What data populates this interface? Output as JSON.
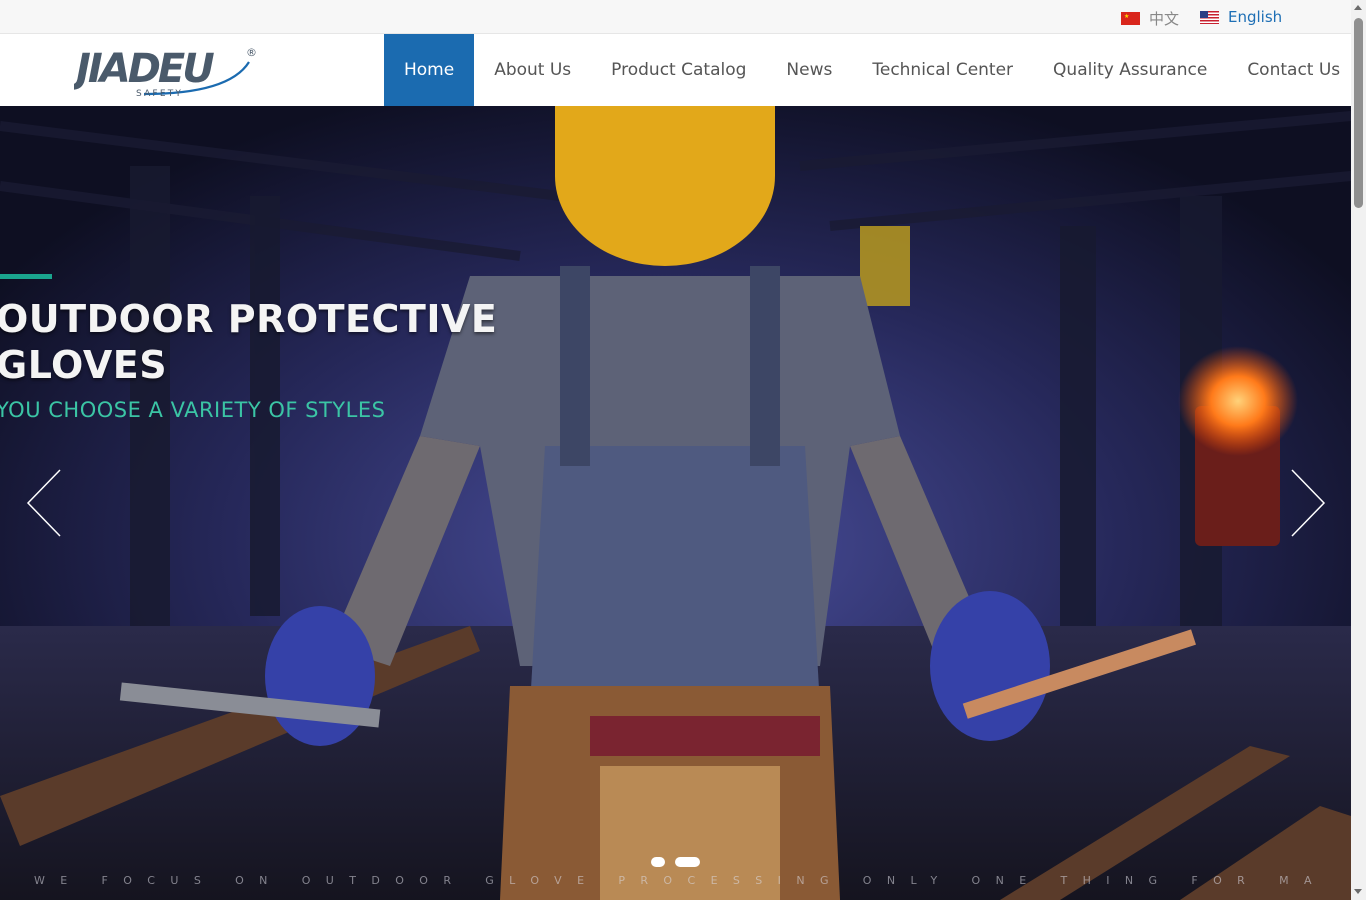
{
  "languages": [
    {
      "label": "中文",
      "icon": "china-flag-icon"
    },
    {
      "label": "English",
      "icon": "us-flag-icon",
      "active": true
    }
  ],
  "brand": {
    "name": "JIADEU",
    "sub": "SAFETY",
    "mark": "®",
    "color": "#4a5a6b",
    "accent": "#1b6bb0"
  },
  "nav": {
    "items": [
      "Home",
      "About Us",
      "Product Catalog",
      "News",
      "Technical Center",
      "Quality Assurance",
      "Contact Us"
    ],
    "active": "Home",
    "active_color": "#1b6bb0"
  },
  "hero": {
    "title_line1": "OUTDOOR PROTECTIVE",
    "title_line2": "GLOVES",
    "subtitle": "YOU CHOOSE A VARIETY OF STYLES",
    "tagline": "WE FOCUS ON OUTDOOR GLOVE PROCESSING ONLY ONE THING FOR MANY YEARS",
    "accent_color": "#1aa58e",
    "prev_icon": "chevron-left-icon",
    "next_icon": "chevron-right-icon",
    "slide_count": 2,
    "current_slide": 2
  }
}
